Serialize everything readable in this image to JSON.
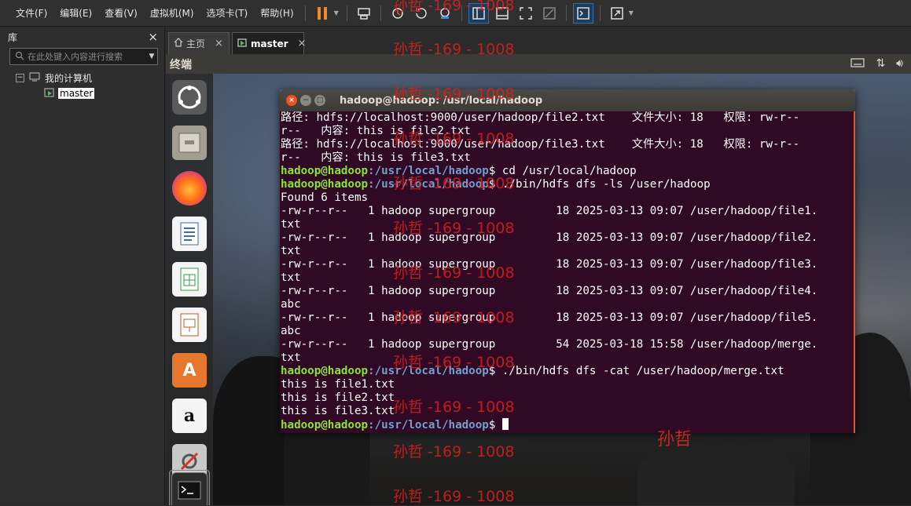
{
  "menubar": {
    "items": [
      "文件(F)",
      "编辑(E)",
      "查看(V)",
      "虚拟机(M)",
      "选项卡(T)",
      "帮助(H)"
    ]
  },
  "library": {
    "title": "库",
    "close": "×",
    "search_placeholder": "在此处键入内容进行搜索",
    "tree": {
      "root": "我的计算机",
      "child": "master"
    }
  },
  "tabs": [
    {
      "label": "主页",
      "close": "×"
    },
    {
      "label": "master",
      "close": "×"
    }
  ],
  "guest": {
    "topbar_title": "终端",
    "terminal_title": "hadoop@hadoop: /usr/local/hadoop",
    "launcher": [
      "ubuntu-dash",
      "files",
      "firefox",
      "writer",
      "calc",
      "impress",
      "software-center",
      "amazon",
      "system-settings",
      "terminal"
    ]
  },
  "terminal": {
    "prompt_user": "hadoop@hadoop",
    "prompt_path": ":/usr/local/hadoop",
    "prompt_suffix": "$ ",
    "lines_before": [
      "路径: hdfs://localhost:9000/user/hadoop/file2.txt    文件大小: 18   权限: rw-r--",
      "r--   内容: this is file2.txt",
      "路径: hdfs://localhost:9000/user/hadoop/file3.txt    文件大小: 18   权限: rw-r--",
      "r--   内容: this is file3.txt"
    ],
    "cmd1": "cd /usr/local/hadoop",
    "cmd2": "./bin/hdfs dfs -ls /user/hadoop",
    "ls_output": [
      "Found 6 items",
      "-rw-r--r--   1 hadoop supergroup         18 2025-03-13 09:07 /user/hadoop/file1.",
      "txt",
      "-rw-r--r--   1 hadoop supergroup         18 2025-03-13 09:07 /user/hadoop/file2.",
      "txt",
      "-rw-r--r--   1 hadoop supergroup         18 2025-03-13 09:07 /user/hadoop/file3.",
      "txt",
      "-rw-r--r--   1 hadoop supergroup         18 2025-03-13 09:07 /user/hadoop/file4.",
      "abc",
      "-rw-r--r--   1 hadoop supergroup         18 2025-03-13 09:07 /user/hadoop/file5.",
      "abc",
      "-rw-r--r--   1 hadoop supergroup         54 2025-03-18 15:58 /user/hadoop/merge.",
      "txt"
    ],
    "cmd3": "./bin/hdfs dfs -cat /user/hadoop/merge.txt",
    "cat_output": [
      "this is file1.txt",
      "this is file2.txt",
      "this is file3.txt"
    ]
  },
  "watermark": {
    "text": "孙哲 -169 - 1008",
    "name": "孙哲"
  }
}
